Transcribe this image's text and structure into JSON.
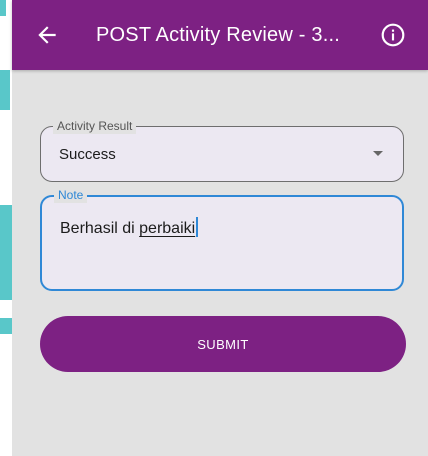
{
  "appbar": {
    "title": "POST Activity Review - 3...",
    "back_icon": "arrow-left-icon",
    "info_icon": "info-icon"
  },
  "form": {
    "activity_result": {
      "label": "Activity Result",
      "value": "Success"
    },
    "note": {
      "label": "Note",
      "value_part1": "Berhasil di ",
      "value_part2": "perbaiki"
    },
    "submit_label": "SUBMIT"
  },
  "colors": {
    "primary": "#7d2183",
    "focus": "#2f88d6",
    "background": "#e2e2e2",
    "accent_teal": "#59c7c9"
  }
}
